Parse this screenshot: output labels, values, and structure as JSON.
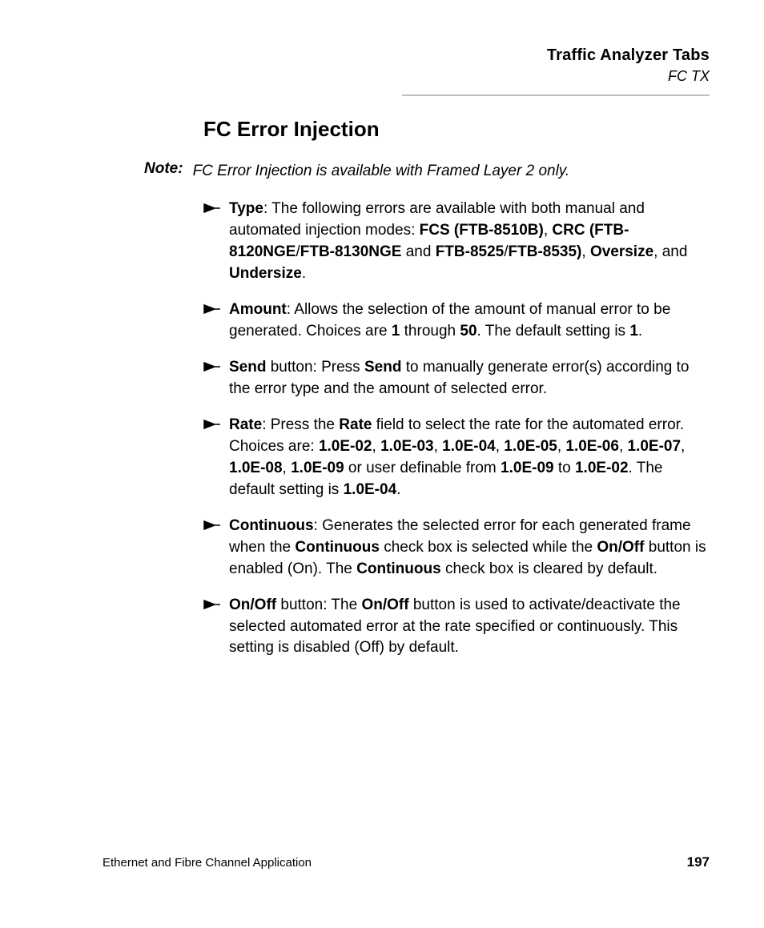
{
  "header": {
    "chapter": "Traffic Analyzer Tabs",
    "section": "FC TX"
  },
  "title": "FC Error Injection",
  "note": {
    "label": "Note:",
    "text": "FC Error Injection is available with Framed Layer 2 only."
  },
  "bullets": {
    "type": {
      "lead": "Type",
      "t1": ": The following errors are available with both manual and automated injection modes: ",
      "b1": "FCS (FTB-8510B)",
      "c1": ", ",
      "b2": "CRC (FTB-8120NGE",
      "c2": "/",
      "b3": "FTB-8130NGE",
      "t2": " and ",
      "b4": "FTB-8525",
      "c3": "/",
      "b5": "FTB-8535)",
      "c4": ", ",
      "b6": "Oversize",
      "c5": ", and ",
      "b7": "Undersize",
      "c6": "."
    },
    "amount": {
      "lead": "Amount",
      "t1": ": Allows the selection of the amount of manual error to be generated. Choices are ",
      "b1": "1",
      "t2": " through ",
      "b2": "50",
      "t3": ". The default setting is ",
      "b3": "1",
      "t4": "."
    },
    "send": {
      "lead": "Send",
      "t1": " button: Press ",
      "b1": "Send",
      "t2": " to manually generate error(s) according to the error type and the amount of selected error."
    },
    "rate": {
      "lead": "Rate",
      "t1": ": Press the ",
      "b1": "Rate",
      "t2": " field to select the rate for the automated error. Choices are: ",
      "r1": "1.0E-02",
      "c1": ", ",
      "r2": "1.0E-03",
      "c2": ", ",
      "r3": "1.0E-04",
      "c3": ", ",
      "r4": "1.0E-05",
      "c4": ", ",
      "r5": "1.0E-06",
      "c5": ", ",
      "r6": "1.0E-07",
      "c6": ", ",
      "r7": "1.0E-08",
      "c7": ", ",
      "r8": "1.0E-09",
      "t3": " or user definable from ",
      "r9": "1.0E-09",
      "t4": " to ",
      "r10": "1.0E-02",
      "t5": ". The default setting is ",
      "r11": "1.0E-04",
      "t6": "."
    },
    "continuous": {
      "lead": "Continuous",
      "t1": ": Generates the selected error for each generated frame when the ",
      "b1": "Continuous",
      "t2": " check box is selected while the ",
      "b2": "On/Off",
      "t3": " button is enabled (On). The ",
      "b3": "Continuous",
      "t4": " check box is cleared by default."
    },
    "onoff": {
      "lead": "On/Off",
      "t1": " button: The ",
      "b1": "On/Off",
      "t2": " button is used to activate/deactivate the selected automated error at the rate specified or continuously. This setting is disabled (Off) by default."
    }
  },
  "footer": {
    "left": "Ethernet and Fibre Channel Application",
    "page": "197"
  }
}
